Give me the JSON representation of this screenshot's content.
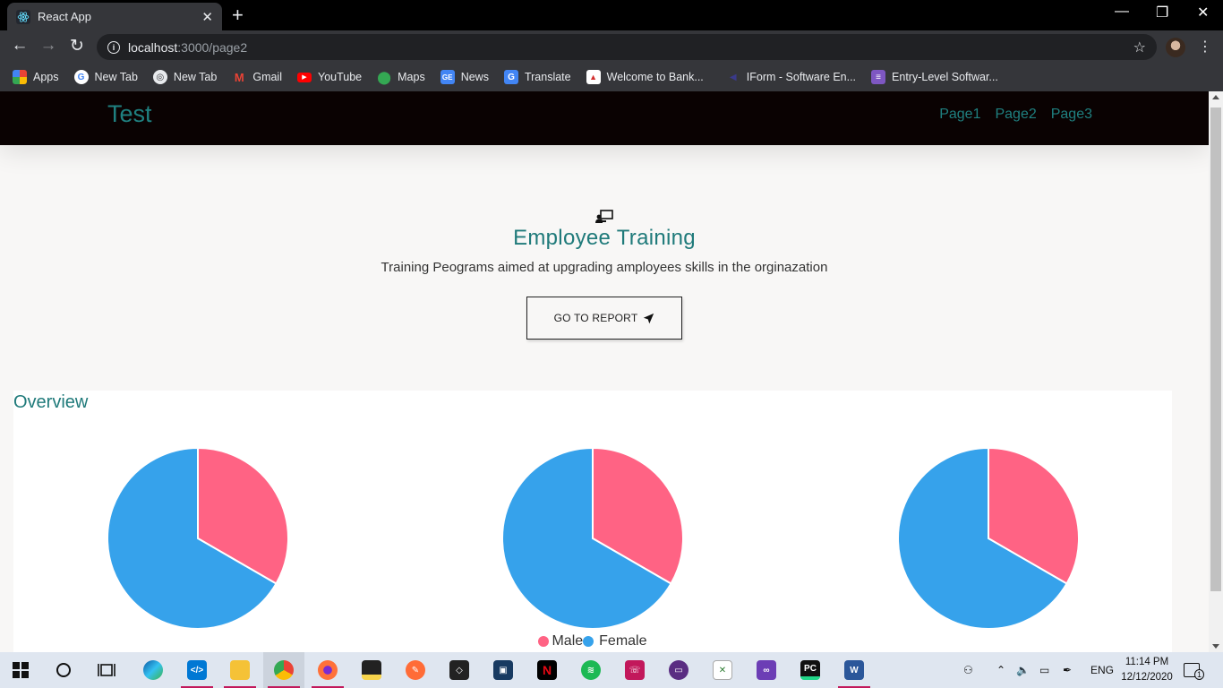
{
  "browser": {
    "tab_title": "React App",
    "url_host": "localhost",
    "url_path": ":3000/page2",
    "bookmarks": [
      {
        "label": "Apps",
        "icon": "apps-grid-icon"
      },
      {
        "label": "New Tab",
        "icon": "google-icon"
      },
      {
        "label": "New Tab",
        "icon": "globe-icon"
      },
      {
        "label": "Gmail",
        "icon": "gmail-icon"
      },
      {
        "label": "YouTube",
        "icon": "youtube-icon"
      },
      {
        "label": "Maps",
        "icon": "maps-icon"
      },
      {
        "label": "News",
        "icon": "news-icon"
      },
      {
        "label": "Translate",
        "icon": "translate-icon"
      },
      {
        "label": "Welcome to Bank...",
        "icon": "bank-icon"
      },
      {
        "label": "IForm - Software En...",
        "icon": "iform-icon"
      },
      {
        "label": "Entry-Level Softwar...",
        "icon": "list-icon"
      }
    ]
  },
  "app": {
    "brand": "Test",
    "nav": [
      "Page1",
      "Page2",
      "Page3"
    ],
    "hero": {
      "title": "Employee Training",
      "subtitle": "Training Peograms aimed at upgrading amployees skills in the orginazation",
      "button": "GO TO REPORT"
    },
    "overview_title": "Overview"
  },
  "chart_data": [
    {
      "type": "pie",
      "categories": [
        "Male",
        "Female"
      ],
      "values": [
        1,
        2
      ],
      "colors": [
        "#ff6384",
        "#36a2eb"
      ],
      "legend": "bottom"
    },
    {
      "type": "pie",
      "categories": [
        "Male",
        "Female"
      ],
      "values": [
        1,
        2
      ],
      "colors": [
        "#ff6384",
        "#36a2eb"
      ],
      "legend": "bottom"
    },
    {
      "type": "pie",
      "categories": [
        "Male",
        "Female"
      ],
      "values": [
        1,
        2
      ],
      "colors": [
        "#ff6384",
        "#36a2eb"
      ],
      "legend": "bottom"
    }
  ],
  "legend": {
    "male": "Male",
    "female": "Female"
  },
  "taskbar": {
    "apps": [
      "start-icon",
      "search-icon",
      "task-view-icon",
      "edge-icon",
      "vscode-icon",
      "file-explorer-icon",
      "chrome-icon",
      "firefox-icon",
      "sticky-notes-icon",
      "postman-icon",
      "unity-icon",
      "virtualbox-icon",
      "netflix-icon",
      "spotify-icon",
      "whatsapp-icon",
      "app-icon",
      "xampp-icon",
      "visual-studio-icon",
      "pycharm-icon",
      "word-icon"
    ],
    "lang": "ENG",
    "time": "11:14 PM",
    "date": "12/12/2020",
    "notifications": "1"
  }
}
